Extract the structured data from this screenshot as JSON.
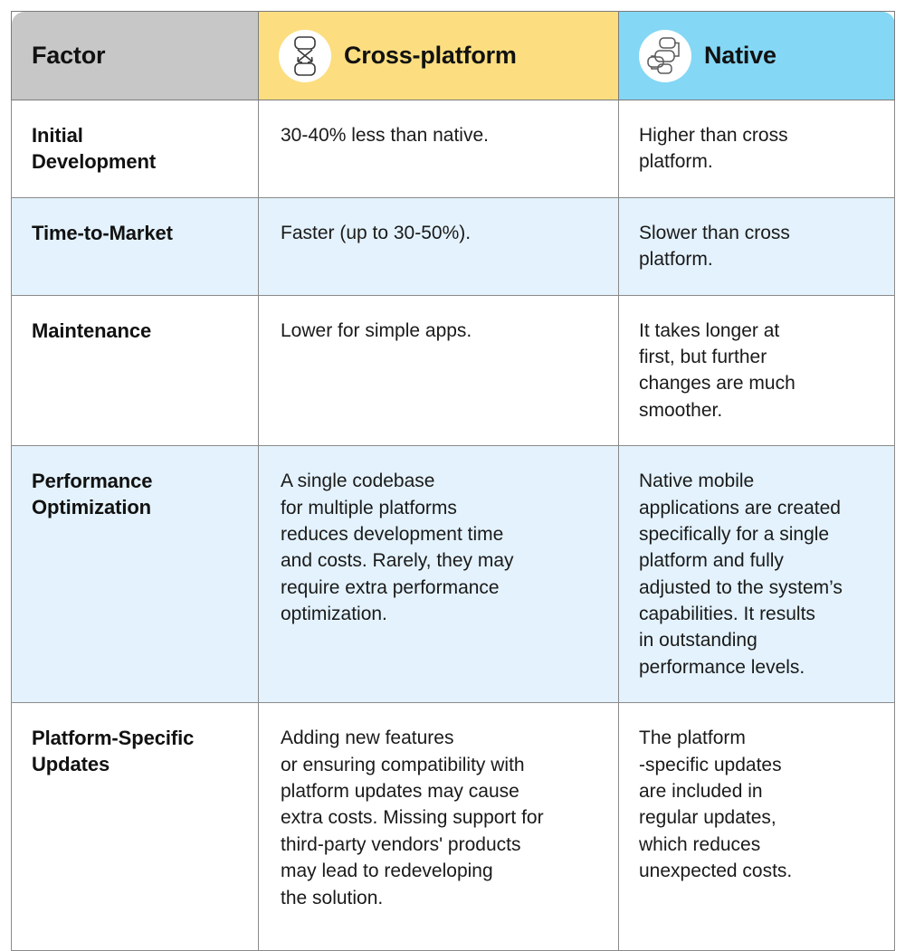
{
  "table": {
    "columns": [
      {
        "key": "factor",
        "label": "Factor",
        "icon": null,
        "header_bg": "#C7C7C7"
      },
      {
        "key": "cross",
        "label": "Cross-platform",
        "icon": "cross-platform-icon",
        "header_bg": "#FCDE80"
      },
      {
        "key": "native",
        "label": "Native",
        "icon": "native-hierarchy-icon",
        "header_bg": "#84D7F5"
      }
    ],
    "row_colors": {
      "odd": "#FFFFFF",
      "even": "#E3F2FC"
    },
    "border_color": "#8A8A8A",
    "rows": [
      {
        "factor": "Initial\nDevelopment",
        "cross": "30-40% less than native.",
        "native": "Higher than cross\nplatform."
      },
      {
        "factor": "Time-to-Market",
        "cross": "Faster (up to 30-50%).",
        "native": "Slower than cross\nplatform."
      },
      {
        "factor": "Maintenance",
        "cross": "Lower for simple apps.",
        "native": "It takes longer at\nfirst, but further\nchanges are much\nsmoother."
      },
      {
        "factor": "Performance\nOptimization",
        "cross": "A single codebase\nfor multiple platforms\nreduces development time\nand costs. Rarely, they may\nrequire extra performance\noptimization.",
        "native": "Native mobile\napplications are created\nspecifically for a single\nplatform and fully\nadjusted to the system’s\ncapabilities. It results\nin outstanding\nperformance levels."
      },
      {
        "factor": "Platform-Specific\nUpdates",
        "cross": "Adding new features\nor ensuring compatibility with\nplatform updates may cause\nextra costs. Missing support for\nthird-party vendors' products\nmay lead to redeveloping\nthe solution.",
        "native": "The platform\n-specific updates\nare included in\nregular updates,\nwhich reduces\nunexpected costs."
      }
    ]
  }
}
